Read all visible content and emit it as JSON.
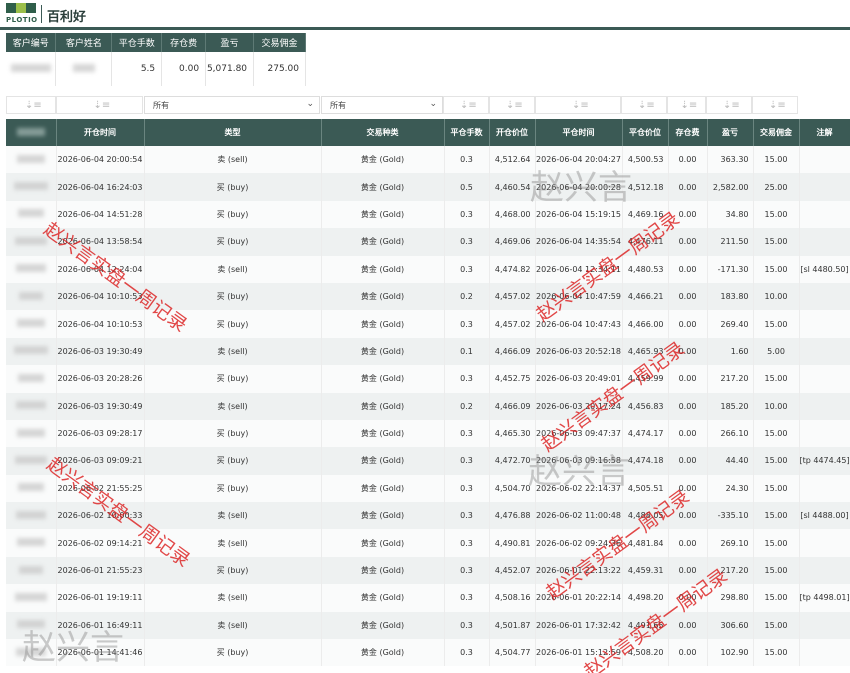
{
  "app": {
    "brand": "百利好",
    "logo_text": "PLOTIO"
  },
  "summary": {
    "headers": [
      "客户编号",
      "客户姓名",
      "平仓手数",
      "存仓费",
      "盈亏",
      "交易佣金"
    ],
    "lots": "5.5",
    "storage": "0.00",
    "pnl": "5,071.80",
    "commission": "275.00"
  },
  "filters": {
    "type_value": "所有",
    "symbol_value": "所有"
  },
  "table": {
    "headers": [
      "订单编号",
      "开仓时间",
      "类型",
      "交易种类",
      "平仓手数",
      "开仓价位",
      "平仓时间",
      "平仓价位",
      "存仓费",
      "盈亏",
      "交易佣金",
      "注解"
    ],
    "rows": [
      {
        "open": "2026-06-04 20:00:54",
        "type": "卖 (sell)",
        "sym": "黄金 (Gold)",
        "lots": "0.3",
        "op": "4,512.64",
        "ct": "2026-06-04 20:04:27",
        "cp": "4,500.53",
        "sto": "0.00",
        "pnl": "363.30",
        "com": "15.00",
        "note": ""
      },
      {
        "open": "2026-06-04 16:24:03",
        "type": "买 (buy)",
        "sym": "黄金 (Gold)",
        "lots": "0.5",
        "op": "4,460.54",
        "ct": "2026-06-04 20:00:28",
        "cp": "4,512.18",
        "sto": "0.00",
        "pnl": "2,582.00",
        "com": "25.00",
        "note": ""
      },
      {
        "open": "2026-06-04 14:51:28",
        "type": "买 (buy)",
        "sym": "黄金 (Gold)",
        "lots": "0.3",
        "op": "4,468.00",
        "ct": "2026-06-04 15:19:15",
        "cp": "4,469.16",
        "sto": "0.00",
        "pnl": "34.80",
        "com": "15.00",
        "note": ""
      },
      {
        "open": "2026-06-04 13:58:54",
        "type": "买 (buy)",
        "sym": "黄金 (Gold)",
        "lots": "0.3",
        "op": "4,469.06",
        "ct": "2026-06-04 14:35:54",
        "cp": "4,476.11",
        "sto": "0.00",
        "pnl": "211.50",
        "com": "15.00",
        "note": ""
      },
      {
        "open": "2026-06-04 12:24:04",
        "type": "卖 (sell)",
        "sym": "黄金 (Gold)",
        "lots": "0.3",
        "op": "4,474.82",
        "ct": "2026-06-04 12:34:11",
        "cp": "4,480.53",
        "sto": "0.00",
        "pnl": "-171.30",
        "com": "15.00",
        "note": "[sl 4480.50]"
      },
      {
        "open": "2026-06-04 10:10:53",
        "type": "买 (buy)",
        "sym": "黄金 (Gold)",
        "lots": "0.2",
        "op": "4,457.02",
        "ct": "2026-06-04 10:47:59",
        "cp": "4,466.21",
        "sto": "0.00",
        "pnl": "183.80",
        "com": "10.00",
        "note": ""
      },
      {
        "open": "2026-06-04 10:10:53",
        "type": "买 (buy)",
        "sym": "黄金 (Gold)",
        "lots": "0.3",
        "op": "4,457.02",
        "ct": "2026-06-04 10:47:43",
        "cp": "4,466.00",
        "sto": "0.00",
        "pnl": "269.40",
        "com": "15.00",
        "note": ""
      },
      {
        "open": "2026-06-03 19:30:49",
        "type": "卖 (sell)",
        "sym": "黄金 (Gold)",
        "lots": "0.1",
        "op": "4,466.09",
        "ct": "2026-06-03 20:52:18",
        "cp": "4,465.93",
        "sto": "0.00",
        "pnl": "1.60",
        "com": "5.00",
        "note": ""
      },
      {
        "open": "2026-06-03 20:28:26",
        "type": "买 (buy)",
        "sym": "黄金 (Gold)",
        "lots": "0.3",
        "op": "4,452.75",
        "ct": "2026-06-03 20:49:01",
        "cp": "4,459.99",
        "sto": "0.00",
        "pnl": "217.20",
        "com": "15.00",
        "note": ""
      },
      {
        "open": "2026-06-03 19:30:49",
        "type": "卖 (sell)",
        "sym": "黄金 (Gold)",
        "lots": "0.2",
        "op": "4,466.09",
        "ct": "2026-06-03 20:17:24",
        "cp": "4,456.83",
        "sto": "0.00",
        "pnl": "185.20",
        "com": "10.00",
        "note": ""
      },
      {
        "open": "2026-06-03 09:28:17",
        "type": "买 (buy)",
        "sym": "黄金 (Gold)",
        "lots": "0.3",
        "op": "4,465.30",
        "ct": "2026-06-03 09:47:37",
        "cp": "4,474.17",
        "sto": "0.00",
        "pnl": "266.10",
        "com": "15.00",
        "note": ""
      },
      {
        "open": "2026-06-03 09:09:21",
        "type": "买 (buy)",
        "sym": "黄金 (Gold)",
        "lots": "0.3",
        "op": "4,472.70",
        "ct": "2026-06-03 09:16:58",
        "cp": "4,474.18",
        "sto": "0.00",
        "pnl": "44.40",
        "com": "15.00",
        "note": "[tp 4474.45]"
      },
      {
        "open": "2026-06-02 21:55:25",
        "type": "买 (buy)",
        "sym": "黄金 (Gold)",
        "lots": "0.3",
        "op": "4,504.70",
        "ct": "2026-06-02 22:14:37",
        "cp": "4,505.51",
        "sto": "0.00",
        "pnl": "24.30",
        "com": "15.00",
        "note": ""
      },
      {
        "open": "2026-06-02 10:00:33",
        "type": "卖 (sell)",
        "sym": "黄金 (Gold)",
        "lots": "0.3",
        "op": "4,476.88",
        "ct": "2026-06-02 11:00:48",
        "cp": "4,488.05",
        "sto": "0.00",
        "pnl": "-335.10",
        "com": "15.00",
        "note": "[sl 4488.00]"
      },
      {
        "open": "2026-06-02 09:14:21",
        "type": "卖 (sell)",
        "sym": "黄金 (Gold)",
        "lots": "0.3",
        "op": "4,490.81",
        "ct": "2026-06-02 09:24:36",
        "cp": "4,481.84",
        "sto": "0.00",
        "pnl": "269.10",
        "com": "15.00",
        "note": ""
      },
      {
        "open": "2026-06-01 21:55:23",
        "type": "买 (buy)",
        "sym": "黄金 (Gold)",
        "lots": "0.3",
        "op": "4,452.07",
        "ct": "2026-06-01 22:13:22",
        "cp": "4,459.31",
        "sto": "0.00",
        "pnl": "217.20",
        "com": "15.00",
        "note": ""
      },
      {
        "open": "2026-06-01 19:19:11",
        "type": "卖 (sell)",
        "sym": "黄金 (Gold)",
        "lots": "0.3",
        "op": "4,508.16",
        "ct": "2026-06-01 20:22:14",
        "cp": "4,498.20",
        "sto": "0.00",
        "pnl": "298.80",
        "com": "15.00",
        "note": "[tp 4498.01]"
      },
      {
        "open": "2026-06-01 16:49:11",
        "type": "卖 (sell)",
        "sym": "黄金 (Gold)",
        "lots": "0.3",
        "op": "4,501.87",
        "ct": "2026-06-01 17:32:42",
        "cp": "4,491.65",
        "sto": "0.00",
        "pnl": "306.60",
        "com": "15.00",
        "note": ""
      },
      {
        "open": "2026-06-01 14:41:46",
        "type": "买 (buy)",
        "sym": "黄金 (Gold)",
        "lots": "0.3",
        "op": "4,504.77",
        "ct": "2026-06-01 15:12:59",
        "cp": "4,508.20",
        "sto": "0.00",
        "pnl": "102.90",
        "com": "15.00",
        "note": ""
      }
    ]
  },
  "watermark": {
    "red": "赵兴言实盘一周记录",
    "gray": "赵兴言"
  }
}
